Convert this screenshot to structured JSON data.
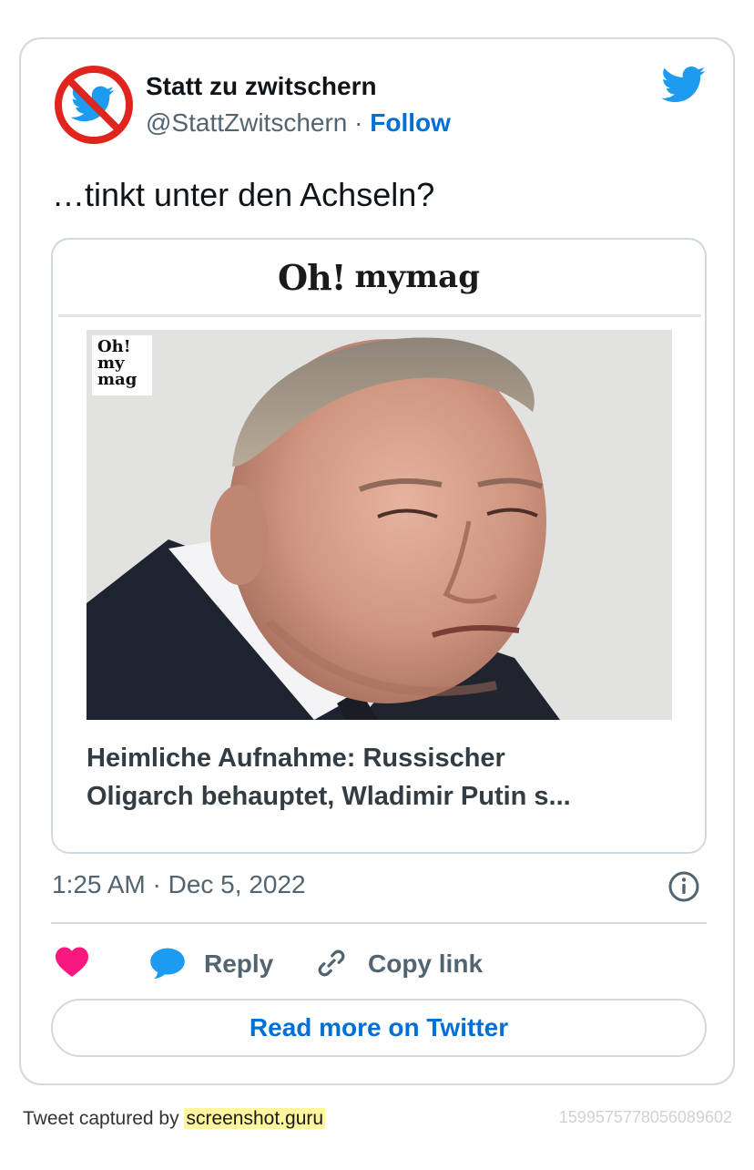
{
  "tweet": {
    "author_name": "Statt zu zwitschern",
    "handle": "@StattZwitschern",
    "separator": "·",
    "follow_label": "Follow",
    "text": "…tinkt unter den Achseln?",
    "timestamp": "1:25 AM · Dec 5, 2022"
  },
  "link_card": {
    "brand_oh": "Oh!",
    "brand_my": "mymag",
    "badge_lines": [
      "Oh!",
      "my",
      "mag"
    ],
    "headline_line1": "Heimliche Aufnahme: Russischer",
    "headline_line2": "Oligarch behauptet, Wladimir Putin s..."
  },
  "actions": {
    "reply_label": "Reply",
    "copy_link_label": "Copy link",
    "read_more_label": "Read more on Twitter"
  },
  "footer": {
    "captured_prefix": "Tweet captured by",
    "captured_site": "screenshot.guru",
    "tweet_id": "1599575778056089602"
  },
  "icons": {
    "avatar": "no-twitter-icon",
    "logo": "twitter-bird-icon",
    "info": "info-icon",
    "like": "heart-icon",
    "reply": "speech-bubble-icon",
    "link": "link-icon"
  },
  "colors": {
    "twitter_blue": "#1d9bf0",
    "link_blue": "#006fd6",
    "heart_pink": "#f91880",
    "muted_text": "#536471",
    "border": "#cfd9de",
    "no_sign_red": "#e0251f"
  }
}
